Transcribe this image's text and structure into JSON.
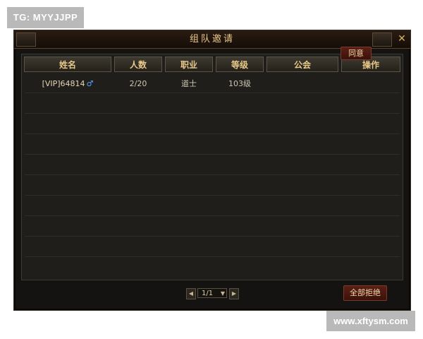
{
  "watermark_top": "TG: MYYJJPP",
  "watermark_bottom": "www.xftysm.com",
  "dialog": {
    "title": "组队邀请",
    "close_glyph": "✕",
    "columns": [
      "姓名",
      "人数",
      "职业",
      "等级",
      "公会",
      "操作"
    ],
    "rows": [
      {
        "name": "[VIP]64814",
        "gender_icon": "♂",
        "members": "2/20",
        "class": "道士",
        "level": "103级",
        "guild": "",
        "action": "同意"
      }
    ],
    "pager": {
      "prev": "◀",
      "page": "1/1",
      "dropdown": "▼",
      "next": "▶"
    },
    "reject_all_label": "全部拒绝"
  },
  "colors": {
    "accent_gold": "#e9c98a",
    "button_red": "#5a1f14"
  }
}
